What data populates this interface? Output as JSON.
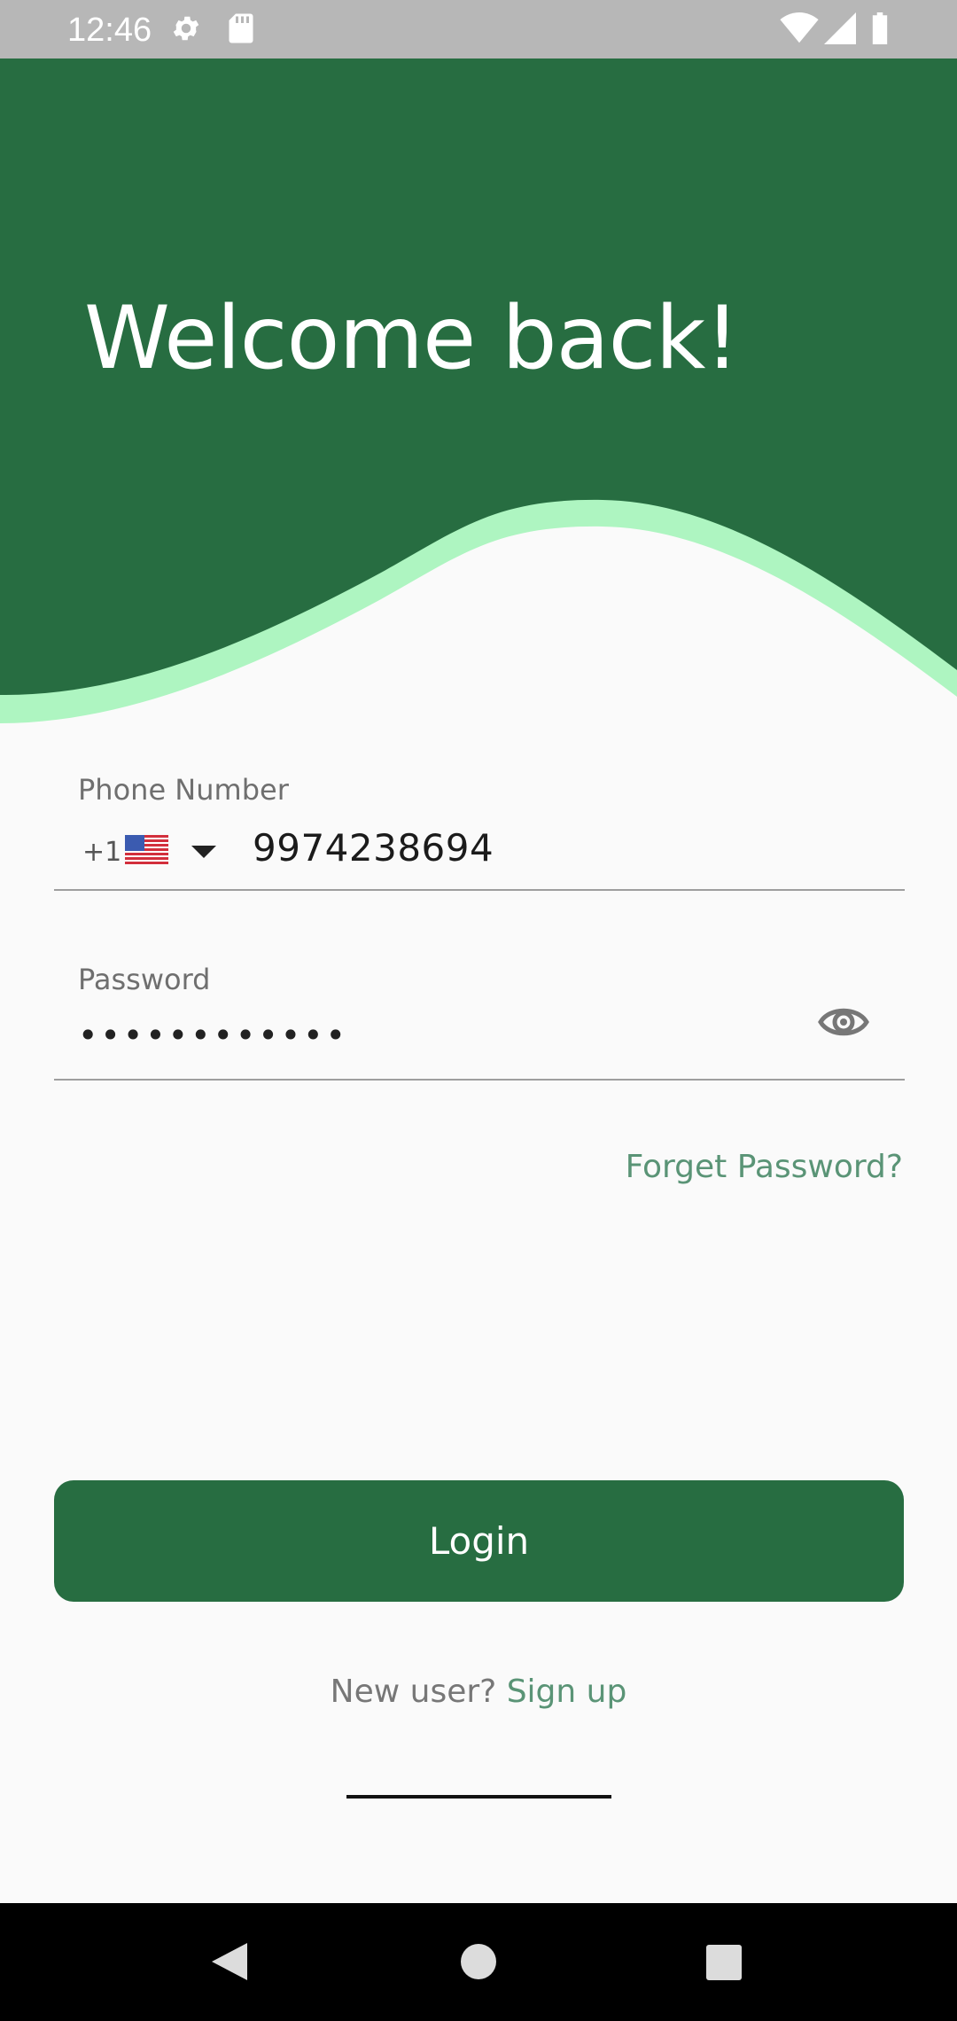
{
  "status_bar": {
    "time": "12:46",
    "icons": [
      "settings-icon",
      "sd-card-icon",
      "wifi-icon",
      "signal-icon",
      "battery-icon"
    ],
    "background": "#b7b7b7"
  },
  "header": {
    "title": "Welcome back!",
    "background": "#276d41",
    "accent": "#aef5c1"
  },
  "phone_field": {
    "label": "Phone Number",
    "country_code": "+1",
    "country_flag": "us-flag",
    "value": "9974238694"
  },
  "password_field": {
    "label": "Password",
    "value": "••••••••••••",
    "toggle_icon": "eye-icon"
  },
  "forget_password": "Forget Password?",
  "login_button": {
    "label": "Login",
    "color": "#276d41"
  },
  "signup": {
    "prompt": "New user?",
    "link": "Sign up",
    "link_color": "#5a9476"
  },
  "nav_bar": {
    "icons": [
      "back-icon",
      "home-icon",
      "recents-icon"
    ]
  }
}
